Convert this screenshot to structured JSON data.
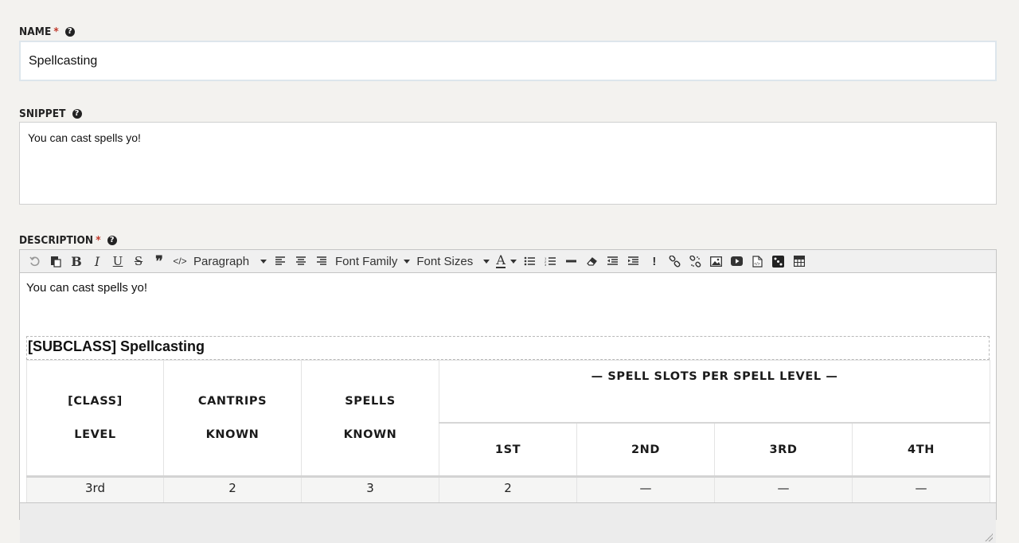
{
  "form": {
    "name": {
      "label": "NAME",
      "required_mark": "*",
      "help": "?",
      "value": "Spellcasting"
    },
    "snippet": {
      "label": "SNIPPET",
      "help": "?",
      "value": "You can cast spells yo!"
    },
    "description": {
      "label": "DESCRIPTION",
      "required_mark": "*",
      "help": "?"
    }
  },
  "toolbar": {
    "paragraph": "Paragraph",
    "font_family": "Font Family",
    "font_sizes": "Font Sizes",
    "buttons": [
      "undo-icon",
      "paste-icon",
      "bold-icon",
      "italic-icon",
      "underline-icon",
      "strikethrough-icon",
      "blockquote-icon",
      "code-icon",
      "align-left-icon",
      "align-center-icon",
      "align-right-icon",
      "text-color-icon",
      "bullet-list-icon",
      "numbered-list-icon",
      "horizontal-rule-icon",
      "clear-format-icon",
      "outdent-icon",
      "indent-icon",
      "exclamation-icon",
      "link-icon",
      "unlink-icon",
      "image-icon",
      "video-icon",
      "embed-icon",
      "dice-icon",
      "table-icon"
    ],
    "labels": {
      "bold": "B",
      "italic": "I",
      "underline": "U",
      "strike": "S",
      "quote": "❞",
      "code": "</>",
      "exclaim": "!",
      "text_color": "A"
    }
  },
  "editor": {
    "paragraph": "You can cast spells yo!",
    "caption": "[SUBCLASS] Spellcasting",
    "table": {
      "col1": [
        "[CLASS]",
        "LEVEL"
      ],
      "col2": [
        "CANTRIPS",
        "KNOWN"
      ],
      "col3": [
        "SPELLS",
        "KNOWN"
      ],
      "group": "— SPELL SLOTS PER SPELL LEVEL —",
      "slots": [
        "1ST",
        "2ND",
        "3RD",
        "4TH"
      ],
      "rows": [
        [
          "3rd",
          "2",
          "3",
          "2",
          "—",
          "—",
          "—"
        ]
      ]
    }
  },
  "colors": {
    "required": "#c0392b",
    "toolbar_bg": "#f0f0f0",
    "page_bg": "#f3f2ef"
  }
}
